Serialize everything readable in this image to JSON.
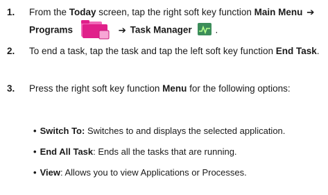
{
  "steps": [
    {
      "num": "1.",
      "parts": {
        "p1": "From the ",
        "b1": "Today",
        "p2": " screen, tap the right soft key function ",
        "b2": "Main Menu",
        "arrow1": "➔",
        "b3": "Programs",
        "arrow2": "➔",
        "b4": "Task Manager",
        "end": "."
      },
      "icons": [
        "programs-folder-icon",
        "task-manager-icon"
      ]
    },
    {
      "num": "2.",
      "parts": {
        "p1": "To end a task, tap the task and tap the left soft key function ",
        "b1": "End Task",
        "end": "."
      }
    },
    {
      "num": "3.",
      "parts": {
        "p1": "Press the right soft key function ",
        "b1": "Menu",
        "p2": " for the following options:"
      }
    }
  ],
  "bullets": [
    {
      "term": "Switch To:",
      "desc": " Switches to and displays the selected application."
    },
    {
      "term": "End All Task",
      "desc": ": Ends all the tasks that are running."
    },
    {
      "term": "View",
      "desc": ": Allows you to view Applications or Processes."
    }
  ],
  "bullet_char": "•",
  "colors": {
    "folder": "#e0208a",
    "folder_back": "#f06ab8",
    "folder_light": "#f7a6d5",
    "taskmgr_bg": "#3c8d5a",
    "taskmgr_line": "#b7ff8f"
  }
}
